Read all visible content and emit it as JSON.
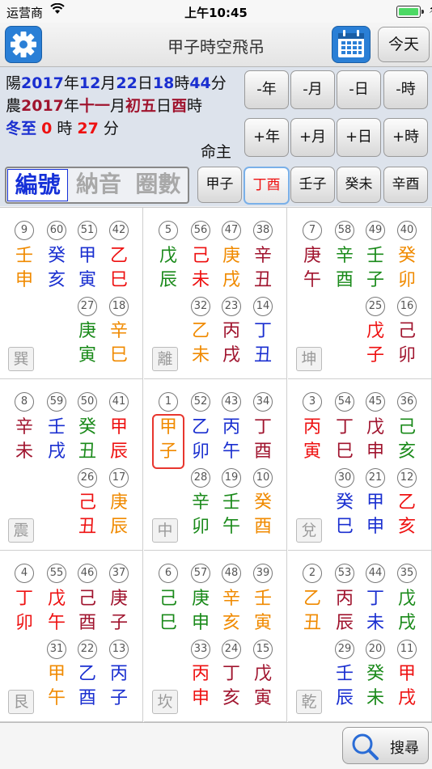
{
  "status": {
    "carrier": "运营商",
    "wifi_icon": "wifi-icon",
    "time": "上午10:45",
    "battery_level": 1.0
  },
  "nav": {
    "title": "甲子時空飛吊",
    "today_label": "今天"
  },
  "date": {
    "solar_prefix": "陽",
    "solar_year": "2017",
    "year_char": "年",
    "solar_month": "12",
    "month_char": "月",
    "solar_day": "22",
    "day_char": "日",
    "solar_hour": "18",
    "hour_char": "時",
    "solar_min": "44",
    "min_char": "分",
    "lunar_prefix": "農",
    "lunar_year": "2017",
    "lunar_month": "十一",
    "lunar_day": "初五",
    "lunar_hour": "酉",
    "term": "冬至",
    "term_h": "0",
    "term_m": "27"
  },
  "controls": {
    "minus_year": "-年",
    "minus_month": "-月",
    "minus_day": "-日",
    "minus_hour": "-時",
    "plus_year": "+年",
    "plus_month": "+月",
    "plus_day": "+日",
    "plus_hour": "+時",
    "mingzhu": "命主"
  },
  "segments": [
    "編號",
    "納音",
    "圈數"
  ],
  "pillars": [
    "甲子",
    "丁酉",
    "壬子",
    "癸未",
    "辛酉"
  ],
  "cells": [
    {
      "gua": "巽",
      "items": [
        {
          "n": "9",
          "gz": [
            "壬",
            "申"
          ],
          "c": "#f08a00"
        },
        {
          "n": "60",
          "gz": [
            "癸",
            "亥"
          ],
          "c": "#1a2fd0"
        },
        {
          "n": "51",
          "gz": [
            "甲",
            "寅"
          ],
          "c": "#1a2fd0"
        },
        {
          "n": "42",
          "gz": [
            "乙",
            "巳"
          ],
          "c": "#ee1111"
        },
        {
          "n": "27",
          "gz": [
            "庚",
            "寅"
          ],
          "c": "#1a8a1a"
        },
        {
          "n": "18",
          "gz": [
            "辛",
            "巳"
          ],
          "c": "#f08a00"
        }
      ]
    },
    {
      "gua": "離",
      "items": [
        {
          "n": "5",
          "gz": [
            "戊",
            "辰"
          ],
          "c": "#1a8a1a"
        },
        {
          "n": "56",
          "gz": [
            "己",
            "未"
          ],
          "c": "#ee1111"
        },
        {
          "n": "47",
          "gz": [
            "庚",
            "戌"
          ],
          "c": "#f08a00"
        },
        {
          "n": "38",
          "gz": [
            "辛",
            "丑"
          ],
          "c": "#a0142e"
        },
        {
          "n": "32",
          "gz": [
            "乙",
            "未"
          ],
          "c": "#f08a00"
        },
        {
          "n": "23",
          "gz": [
            "丙",
            "戌"
          ],
          "c": "#a0142e"
        },
        {
          "n": "14",
          "gz": [
            "丁",
            "丑"
          ],
          "c": "#1a2fd0"
        }
      ]
    },
    {
      "gua": "坤",
      "items": [
        {
          "n": "7",
          "gz": [
            "庚",
            "午"
          ],
          "c": "#a0142e"
        },
        {
          "n": "58",
          "gz": [
            "辛",
            "酉"
          ],
          "c": "#1a8a1a"
        },
        {
          "n": "49",
          "gz": [
            "壬",
            "子"
          ],
          "c": "#1a8a1a"
        },
        {
          "n": "40",
          "gz": [
            "癸",
            "卯"
          ],
          "c": "#f08a00"
        },
        {
          "n": "25",
          "gz": [
            "戊",
            "子"
          ],
          "c": "#ee1111"
        },
        {
          "n": "16",
          "gz": [
            "己",
            "卯"
          ],
          "c": "#a0142e"
        }
      ]
    },
    {
      "gua": "震",
      "items": [
        {
          "n": "8",
          "gz": [
            "辛",
            "未"
          ],
          "c": "#a0142e"
        },
        {
          "n": "59",
          "gz": [
            "壬",
            "戌"
          ],
          "c": "#1a2fd0"
        },
        {
          "n": "50",
          "gz": [
            "癸",
            "丑"
          ],
          "c": "#1a8a1a"
        },
        {
          "n": "41",
          "gz": [
            "甲",
            "辰"
          ],
          "c": "#ee1111"
        },
        {
          "n": "26",
          "gz": [
            "己",
            "丑"
          ],
          "c": "#ee1111"
        },
        {
          "n": "17",
          "gz": [
            "庚",
            "辰"
          ],
          "c": "#f08a00"
        }
      ]
    },
    {
      "gua": "中",
      "items": [
        {
          "n": "1",
          "gz": [
            "甲",
            "子"
          ],
          "c": "#f08a00"
        },
        {
          "n": "52",
          "gz": [
            "乙",
            "卯"
          ],
          "c": "#1a2fd0"
        },
        {
          "n": "43",
          "gz": [
            "丙",
            "午"
          ],
          "c": "#1a2fd0"
        },
        {
          "n": "34",
          "gz": [
            "丁",
            "酉"
          ],
          "c": "#a0142e"
        },
        {
          "n": "28",
          "gz": [
            "辛",
            "卯"
          ],
          "c": "#1a8a1a"
        },
        {
          "n": "19",
          "gz": [
            "壬",
            "午"
          ],
          "c": "#1a8a1a"
        },
        {
          "n": "10",
          "gz": [
            "癸",
            "酉"
          ],
          "c": "#f08a00"
        }
      ]
    },
    {
      "gua": "兌",
      "items": [
        {
          "n": "3",
          "gz": [
            "丙",
            "寅"
          ],
          "c": "#ee1111"
        },
        {
          "n": "54",
          "gz": [
            "丁",
            "巳"
          ],
          "c": "#a0142e"
        },
        {
          "n": "45",
          "gz": [
            "戊",
            "申"
          ],
          "c": "#a0142e"
        },
        {
          "n": "36",
          "gz": [
            "己",
            "亥"
          ],
          "c": "#1a8a1a"
        },
        {
          "n": "30",
          "gz": [
            "癸",
            "巳"
          ],
          "c": "#1a2fd0"
        },
        {
          "n": "21",
          "gz": [
            "甲",
            "申"
          ],
          "c": "#1a2fd0"
        },
        {
          "n": "12",
          "gz": [
            "乙",
            "亥"
          ],
          "c": "#ee1111"
        }
      ]
    },
    {
      "gua": "艮",
      "items": [
        {
          "n": "4",
          "gz": [
            "丁",
            "卯"
          ],
          "c": "#ee1111"
        },
        {
          "n": "55",
          "gz": [
            "戊",
            "午"
          ],
          "c": "#ee1111"
        },
        {
          "n": "46",
          "gz": [
            "己",
            "酉"
          ],
          "c": "#a0142e"
        },
        {
          "n": "37",
          "gz": [
            "庚",
            "子"
          ],
          "c": "#a0142e"
        },
        {
          "n": "31",
          "gz": [
            "甲",
            "午"
          ],
          "c": "#f08a00"
        },
        {
          "n": "22",
          "gz": [
            "乙",
            "酉"
          ],
          "c": "#1a2fd0"
        },
        {
          "n": "13",
          "gz": [
            "丙",
            "子"
          ],
          "c": "#1a2fd0"
        }
      ]
    },
    {
      "gua": "坎",
      "items": [
        {
          "n": "6",
          "gz": [
            "己",
            "巳"
          ],
          "c": "#1a8a1a"
        },
        {
          "n": "57",
          "gz": [
            "庚",
            "申"
          ],
          "c": "#1a8a1a"
        },
        {
          "n": "48",
          "gz": [
            "辛",
            "亥"
          ],
          "c": "#f08a00"
        },
        {
          "n": "39",
          "gz": [
            "壬",
            "寅"
          ],
          "c": "#f08a00"
        },
        {
          "n": "33",
          "gz": [
            "丙",
            "申"
          ],
          "c": "#ee1111"
        },
        {
          "n": "24",
          "gz": [
            "丁",
            "亥"
          ],
          "c": "#a0142e"
        },
        {
          "n": "15",
          "gz": [
            "戊",
            "寅"
          ],
          "c": "#a0142e"
        }
      ]
    },
    {
      "gua": "乾",
      "items": [
        {
          "n": "2",
          "gz": [
            "乙",
            "丑"
          ],
          "c": "#f08a00"
        },
        {
          "n": "53",
          "gz": [
            "丙",
            "辰"
          ],
          "c": "#a0142e"
        },
        {
          "n": "44",
          "gz": [
            "丁",
            "未"
          ],
          "c": "#1a2fd0"
        },
        {
          "n": "35",
          "gz": [
            "戊",
            "戌"
          ],
          "c": "#1a8a1a"
        },
        {
          "n": "29",
          "gz": [
            "壬",
            "辰"
          ],
          "c": "#1a2fd0"
        },
        {
          "n": "20",
          "gz": [
            "癸",
            "未"
          ],
          "c": "#1a8a1a"
        },
        {
          "n": "11",
          "gz": [
            "甲",
            "戌"
          ],
          "c": "#ee1111"
        }
      ]
    }
  ],
  "search_label": "搜尋"
}
